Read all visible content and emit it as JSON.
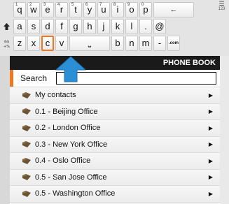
{
  "keyboard": {
    "row1": [
      {
        "num": "1",
        "label": "q"
      },
      {
        "num": "2",
        "label": "w"
      },
      {
        "num": "3",
        "label": "e"
      },
      {
        "num": "4",
        "label": "r"
      },
      {
        "num": "5",
        "label": "t"
      },
      {
        "num": "6",
        "label": "y"
      },
      {
        "num": "7",
        "label": "u"
      },
      {
        "num": "8",
        "label": "i"
      },
      {
        "num": "9",
        "label": "o"
      },
      {
        "num": "0",
        "label": "p"
      },
      {
        "num": "",
        "label": "←"
      }
    ],
    "row2": [
      "a",
      "s",
      "d",
      "f",
      "g",
      "h",
      "j",
      "k",
      "l",
      ".",
      "@"
    ],
    "row3": [
      "z",
      "x",
      "c",
      "v",
      "⎵",
      "b",
      "n",
      "m",
      "-",
      ".com"
    ],
    "mode_label": "123",
    "highlighted_key": "c"
  },
  "phonebook": {
    "title": "PHONE BOOK",
    "search_label": "Search",
    "search_value": "",
    "items": [
      "My contacts",
      "0.1 - Beijing Office",
      "0.2 - London Office",
      "0.3 - New York Office",
      "0.4 - Oslo Office",
      "0.5 - San Jose Office",
      "0.5 - Washington Office"
    ]
  },
  "colors": {
    "accent": "#f07820",
    "header_bg": "#1a1a1a",
    "arrow": "#2b8fd6"
  }
}
